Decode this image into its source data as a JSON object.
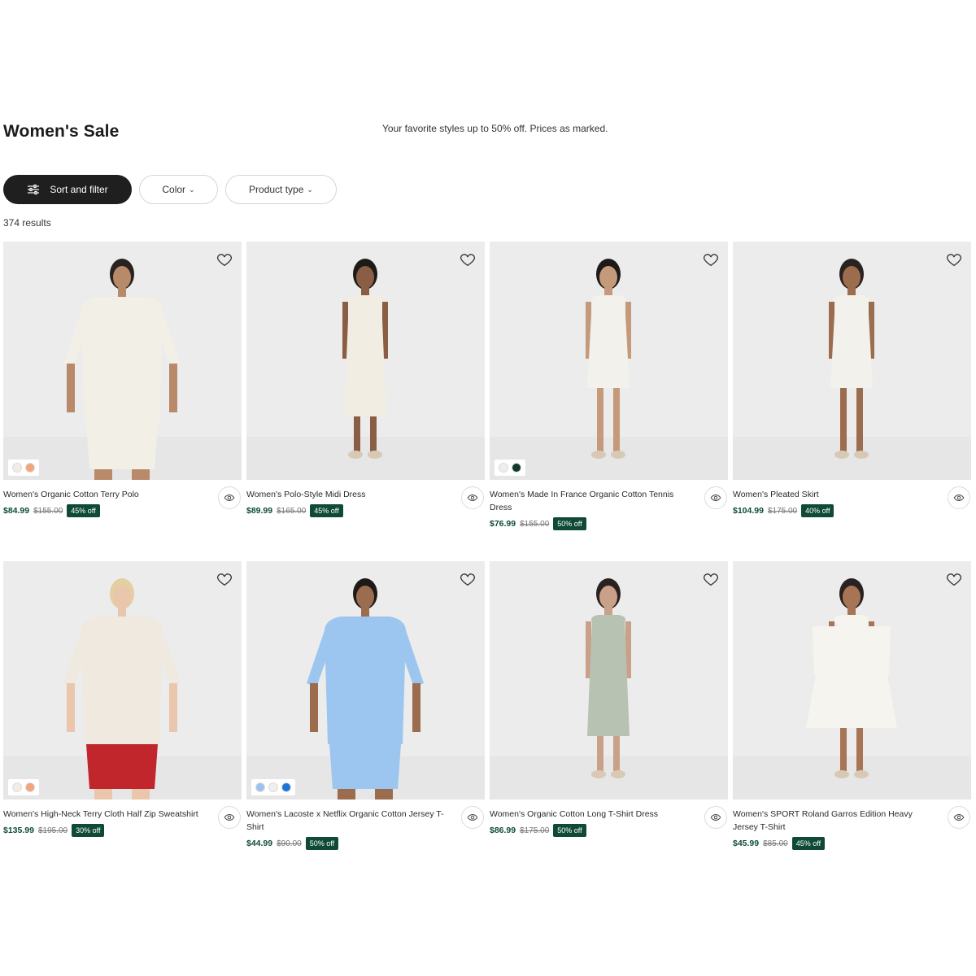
{
  "header": {
    "title": "Women's Sale",
    "subtitle": "Your favorite styles up to 50% off. Prices as marked."
  },
  "filters": {
    "sort_label": "Sort and filter",
    "color_label": "Color",
    "product_type_label": "Product type"
  },
  "results": "374 results",
  "colors": {
    "accent": "#0e4a36",
    "price": "#0c4d3a",
    "dark_button": "#1f1f1f"
  },
  "products": [
    {
      "name": "Women's Organic Cotton Terry Polo",
      "price": "$84.99",
      "old_price": "$155.00",
      "discount": "45% off",
      "swatches": [
        "#f1ede4",
        "#f2a57a"
      ]
    },
    {
      "name": "Women's Polo-Style Midi Dress",
      "price": "$89.99",
      "old_price": "$165.00",
      "discount": "45% off",
      "swatches": []
    },
    {
      "name": "Women's Made In France Organic Cotton Tennis Dress",
      "price": "$76.99",
      "old_price": "$155.00",
      "discount": "50% off",
      "swatches": [
        "#eeeeea",
        "#123a2a"
      ]
    },
    {
      "name": "Women's Pleated Skirt",
      "price": "$104.99",
      "old_price": "$175.00",
      "discount": "40% off",
      "swatches": []
    },
    {
      "name": "Women's High-Neck Terry Cloth Half Zip Sweatshirt",
      "price": "$135.99",
      "old_price": "$195.00",
      "discount": "30% off",
      "swatches": [
        "#f1ede4",
        "#f2a57a"
      ]
    },
    {
      "name": "Women's Lacoste x Netflix Organic Cotton Jersey T-Shirt",
      "price": "$44.99",
      "old_price": "$90.00",
      "discount": "50% off",
      "swatches": [
        "#9cc3ef",
        "#eeeeee",
        "#1b74d6"
      ]
    },
    {
      "name": "Women's Organic Cotton Long T-Shirt Dress",
      "price": "$86.99",
      "old_price": "$175.00",
      "discount": "50% off",
      "swatches": []
    },
    {
      "name": "Women's SPORT Roland Garros Edition Heavy Jersey T-Shirt",
      "price": "$45.99",
      "old_price": "$85.00",
      "discount": "45% off",
      "swatches": []
    }
  ],
  "icons": {
    "favorite": "heart-icon",
    "quick_view": "eye-icon",
    "sort": "sliders-icon",
    "dropdown": "chevron-down-icon"
  }
}
